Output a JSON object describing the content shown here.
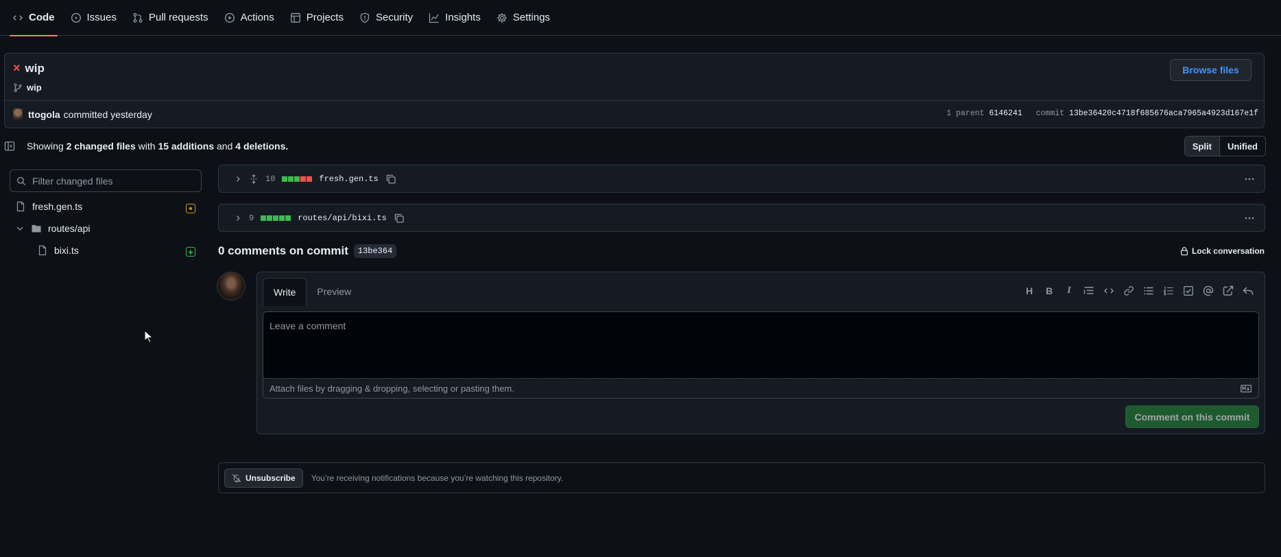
{
  "nav": {
    "tabs": [
      {
        "label": "Code",
        "icon": "code-icon"
      },
      {
        "label": "Issues",
        "icon": "issue-icon"
      },
      {
        "label": "Pull requests",
        "icon": "pull-request-icon"
      },
      {
        "label": "Actions",
        "icon": "play-icon"
      },
      {
        "label": "Projects",
        "icon": "table-icon"
      },
      {
        "label": "Security",
        "icon": "shield-icon"
      },
      {
        "label": "Insights",
        "icon": "graph-icon"
      },
      {
        "label": "Settings",
        "icon": "gear-icon"
      }
    ],
    "active": "Code"
  },
  "commit": {
    "title": "wip",
    "branch": "wip",
    "browse_label": "Browse files",
    "author": "ttogola",
    "committed_text": "committed yesterday",
    "parent_label": "1 parent",
    "parent_sha": "6146241",
    "commit_label": "commit",
    "commit_sha": "13be36420c4718f685676aca7965a4923d167e1f"
  },
  "summary": {
    "showing": "Showing",
    "changed_files": "2 changed files",
    "with": "with",
    "additions": "15 additions",
    "and": "and",
    "deletions": "4 deletions.",
    "split_label": "Split",
    "unified_label": "Unified"
  },
  "file_tree": {
    "filter_placeholder": "Filter changed files",
    "items": [
      {
        "label": "fresh.gen.ts",
        "status": "modified"
      },
      {
        "label": "routes/api",
        "type": "folder"
      },
      {
        "label": "bixi.ts",
        "status": "added"
      }
    ]
  },
  "files": [
    {
      "count": "10",
      "name": "fresh.gen.ts",
      "diffstat": [
        "add",
        "add",
        "add",
        "del",
        "del"
      ]
    },
    {
      "count": "9",
      "name": "routes/api/bixi.ts",
      "diffstat": [
        "add",
        "add",
        "add",
        "add",
        "add"
      ]
    }
  ],
  "comments": {
    "title": "0 comments on commit",
    "sha": "13be364",
    "lock_label": "Lock conversation",
    "write_tab": "Write",
    "preview_tab": "Preview",
    "placeholder": "Leave a comment",
    "attach_text": "Attach files by dragging & dropping, selecting or pasting them.",
    "submit_label": "Comment on this commit"
  },
  "notifications": {
    "button_label": "Unsubscribe",
    "text": "You’re receiving notifications because you’re watching this repository."
  },
  "colors": {
    "accent": "#f78166",
    "link": "#4493f8",
    "added": "#3fb950",
    "deleted": "#f85149",
    "modified": "#d29922",
    "success_button": "#238636"
  }
}
